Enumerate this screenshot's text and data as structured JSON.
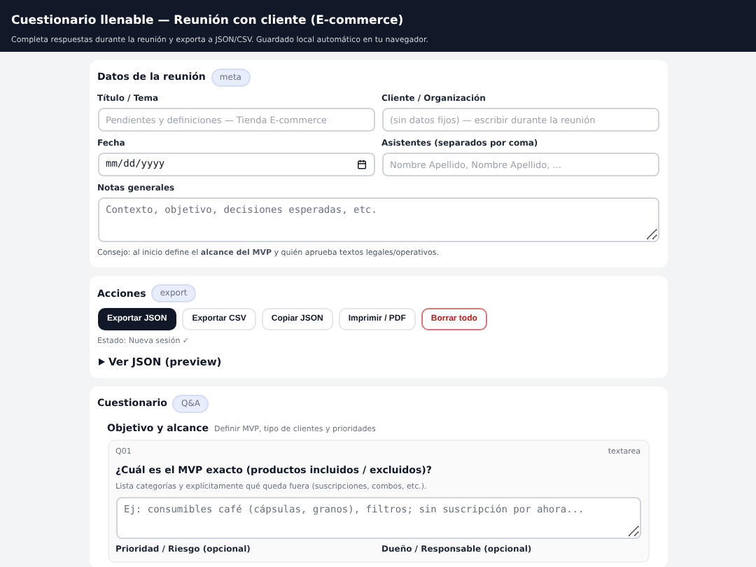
{
  "header": {
    "title": "Cuestionario llenable — Reunión con cliente (E-commerce)",
    "subtitle": "Completa respuestas durante la reunión y exporta a JSON/CSV. Guardado local automático en tu navegador."
  },
  "meeting": {
    "title": "Datos de la reunión",
    "badge": "meta",
    "fields": [
      {
        "kind": "text",
        "label": "Título / Tema",
        "placeholder": "Pendientes y definiciones — Tienda E-commerce"
      },
      {
        "kind": "text",
        "label": "Cliente / Organización",
        "placeholder": "(sin datos fijos) — escribir durante la reunión"
      },
      {
        "kind": "date",
        "label": "Fecha",
        "placeholder": "mm/dd/yyyy"
      },
      {
        "kind": "text",
        "label": "Asistentes (separados por coma)",
        "placeholder": "Nombre Apellido, Nombre Apellido, ..."
      }
    ],
    "notes": {
      "label": "Notas generales",
      "placeholder": "Contexto, objetivo, decisiones esperadas, etc."
    },
    "tip": "Consejo: al inicio define el **alcance del MVP** y quién aprueba textos legales/operativos."
  },
  "actions": {
    "title": "Acciones",
    "badge": "export",
    "buttons": [
      {
        "label": "Exportar JSON",
        "kind": "primary"
      },
      {
        "label": "Exportar CSV",
        "kind": "default"
      },
      {
        "label": "Copiar JSON",
        "kind": "default"
      },
      {
        "label": "Imprimir / PDF",
        "kind": "default"
      },
      {
        "label": "Borrar todo",
        "kind": "danger"
      }
    ],
    "status": "Estado: Nueva sesión ✓",
    "preview": {
      "label": "Ver JSON (preview)",
      "expanded": false
    }
  },
  "questionnaire": {
    "title": "Cuestionario",
    "badge": "Q&A",
    "section": {
      "title": "Objetivo y alcance",
      "subtitle": "Definir MVP, tipo de clientes y prioridades",
      "question": {
        "id": "Q01",
        "type": "textarea",
        "text": "¿Cuál es el MVP exacto (productos incluidos / excluidos)?",
        "hint": "Lista categorías y explícitamente qué queda fuera (suscripciones, combos, etc.).",
        "placeholder": "Ej: consumibles café (cápsulas, granos), filtros; sin suscripción por ahora...",
        "extra_fields": [
          "Prioridad / Riesgo (opcional)",
          "Dueño / Responsable (opcional)"
        ]
      }
    }
  }
}
